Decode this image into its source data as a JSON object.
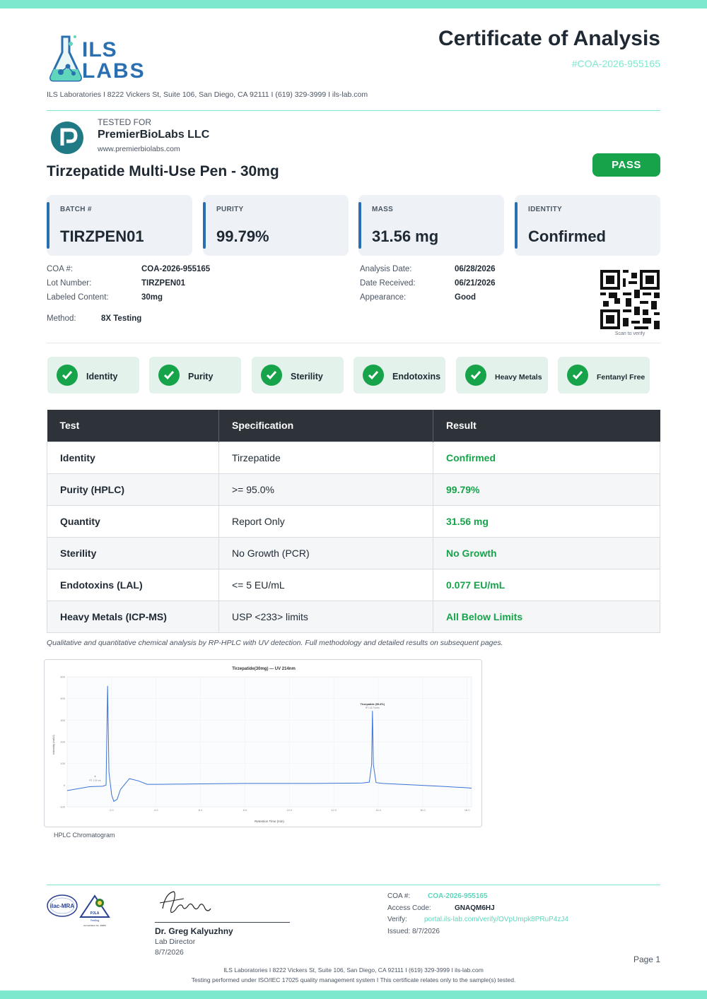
{
  "header": {
    "logo_line1": "ILS",
    "logo_line2": "LABS",
    "title": "Certificate of Analysis",
    "coa_number": "#COA-2026-955165",
    "address": "ILS Laboratories  I  8222 Vickers St, Suite 106, San Diego, CA 92111  I  (619) 329-3999  I  ils-lab.com"
  },
  "client": {
    "tested_for_label": "TESTED FOR",
    "name": "PremierBioLabs LLC",
    "website": "www.premierbiolabs.com"
  },
  "product": {
    "name": "Tirzepatide Multi-Use Pen - 30mg",
    "status": "PASS"
  },
  "summary_cards": [
    {
      "label": "BATCH #",
      "value": "TIRZPEN01"
    },
    {
      "label": "PURITY",
      "value": "99.79%"
    },
    {
      "label": "MASS",
      "value": "31.56 mg"
    },
    {
      "label": "IDENTITY",
      "value": "Confirmed"
    }
  ],
  "details": {
    "coa_label": "COA #:",
    "coa_value": "COA-2026-955165",
    "lot_label": "Lot Number:",
    "lot_value": "TIRZPEN01",
    "labeled_label": "Labeled Content:",
    "labeled_value": "30mg",
    "method_label": "Method:",
    "method_value": "8X Testing",
    "analysis_date_label": "Analysis Date:",
    "analysis_date_value": "06/28/2026",
    "received_label": "Date Received:",
    "received_value": "06/21/2026",
    "appearance_label": "Appearance:",
    "appearance_value": "Good",
    "qr_caption": "Scan to verify"
  },
  "tests_passed": [
    "Identity",
    "Purity",
    "Sterility",
    "Endotoxins",
    "Heavy Metals",
    "Fentanyl Free"
  ],
  "results_table": {
    "headers": [
      "Test",
      "Specification",
      "Result"
    ],
    "rows": [
      {
        "test": "Identity",
        "spec": "Tirzepatide",
        "result": "Confirmed"
      },
      {
        "test": "Purity (HPLC)",
        "spec": ">= 95.0%",
        "result": "99.79%"
      },
      {
        "test": "Quantity",
        "spec": "Report Only",
        "result": "31.56 mg"
      },
      {
        "test": "Sterility",
        "spec": "No Growth (PCR)",
        "result": "No Growth"
      },
      {
        "test": "Endotoxins (LAL)",
        "spec": "<= 5 EU/mL",
        "result": "0.077 EU/mL"
      },
      {
        "test": "Heavy Metals (ICP-MS)",
        "spec": "USP <233> limits",
        "result": "All Below Limits"
      }
    ],
    "note": "Qualitative and quantitative chemical analysis by RP-HPLC with UV detection. Full methodology and detailed results on subsequent pages."
  },
  "chromatogram": {
    "title": "Tirzepatide(30mg) — UV 214nm",
    "xlabel": "Retention Time (min)",
    "ylabel": "Intensity (mAU)",
    "corner_label": "214nm",
    "peak_label": "Tirzepatide (99.8%)",
    "peak_sublabel": "RT: 13.74 min",
    "small_peak_label": "T",
    "small_peak_sublabel": "RT: 1.26 min",
    "caption": "HPLC Chromatogram",
    "yticks": [
      "500",
      "400",
      "300",
      "200",
      "100",
      "0",
      "-100"
    ],
    "xticks": [
      "2.0",
      "4.0",
      "6.0",
      "8.0",
      "10.0",
      "12.0",
      "14.0",
      "16.0",
      "18.0"
    ]
  },
  "chart_data": {
    "type": "line",
    "title": "Tirzepatide(30mg) — UV 214nm",
    "xlabel": "Retention Time (min)",
    "ylabel": "Intensity (mAU)",
    "xlim": [
      0,
      18.2
    ],
    "ylim": [
      -100,
      500
    ],
    "series": [
      {
        "x": [
          0,
          1.0,
          1.6,
          1.75,
          1.82,
          1.88,
          2.0,
          2.1,
          2.25,
          2.4,
          2.8,
          3.2,
          3.6,
          4.2,
          6.0,
          8.0,
          10.0,
          11.0,
          13.3,
          13.6,
          13.7,
          13.74,
          13.78,
          13.9,
          14.2,
          16.0,
          18.0,
          18.2
        ],
        "y": [
          -25,
          -7,
          -5,
          0,
          458,
          60,
          -45,
          -75,
          -65,
          -20,
          30,
          20,
          4,
          4,
          6,
          8,
          8,
          8,
          10,
          14,
          95,
          343,
          95,
          12,
          8,
          -1,
          -12,
          -14
        ]
      }
    ],
    "annotations": [
      "Tirzepatide (99.8%)",
      "RT: 13.74 min"
    ],
    "grid": true
  },
  "footer": {
    "signer_name": "Dr. Greg Kalyuzhny",
    "signer_role": "Lab Director",
    "signer_date": "8/7/2026",
    "coa_label": "COA #:",
    "coa_value": "COA-2026-955165",
    "access_label": "Access Code:",
    "access_value": "GNAQM6HJ",
    "verify_label": "Verify:",
    "verify_value": "portal.ils-lab.com/verify/OVpUmpk8PRuP4zJ4",
    "issued_label": "Issued:",
    "issued_value": "8/7/2026",
    "page": "Page 1",
    "line1": "ILS Laboratories  I  8222 Vickers St, Suite 106, San Diego, CA 92111  I  (619) 329-3999  I  ils-lab.com",
    "line2": "Testing performed under ISO/IEC 17025 quality management system  I  This certificate relates only to the sample(s) tested.",
    "ilac_text": "ilac-MRA",
    "pjla_text": "PJLA",
    "pjla_sub": "Testing",
    "pjla_acc": "Accreditation No. 99953"
  },
  "colors": {
    "accent_teal": "#7ee8cf",
    "brand_blue": "#2a6fb0",
    "pass_green": "#16a34a",
    "table_header": "#2d3339"
  }
}
